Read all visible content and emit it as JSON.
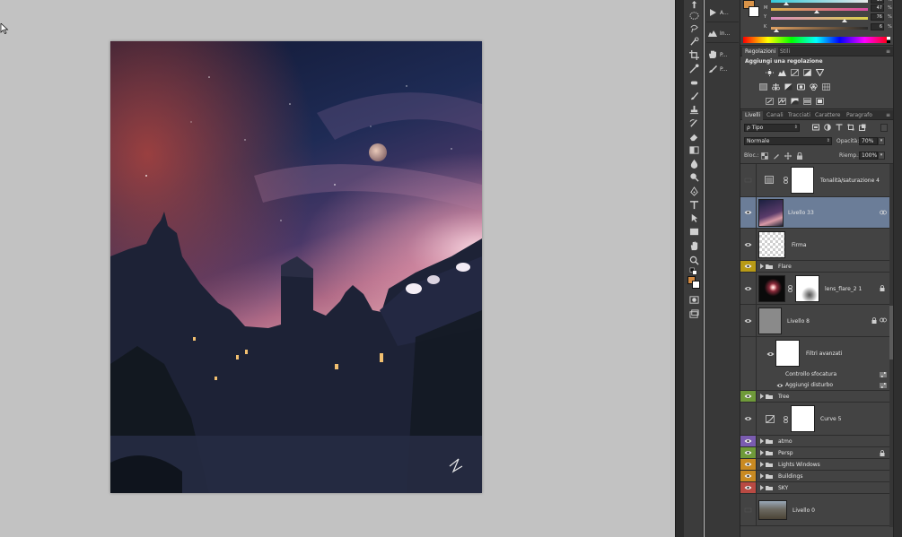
{
  "colors": {
    "workspace": "#c2c2c2",
    "panel": "#434343",
    "selected_layer": "#6b7d98",
    "foreground_swatch": "#d38a40",
    "background_swatch": "#ffffff",
    "label_yellow": "#b89a16",
    "label_green": "#6f9a3a",
    "label_violet": "#7a5cb0",
    "label_orange": "#c98a22",
    "label_red": "#b94a43"
  },
  "history": {
    "items": [
      {
        "label": "A...",
        "icon": "play-icon"
      },
      {
        "label": "In...",
        "icon": "levels-icon"
      },
      {
        "label": "P...",
        "icon": "hand-icon"
      },
      {
        "label": "P...",
        "icon": "brush-icon"
      }
    ]
  },
  "color_panel": {
    "rows": [
      {
        "letter": "",
        "value": "16",
        "pct": "%",
        "color_from": "#33c9d9",
        "color_to": "#e8e8e8",
        "pos": 0.16
      },
      {
        "letter": "M",
        "value": "47",
        "pct": "%",
        "color_from": "#d9b24a",
        "color_to": "#d94aa5",
        "pos": 0.47
      },
      {
        "letter": "Y",
        "value": "76",
        "pct": "%",
        "color_from": "#d98bc0",
        "color_to": "#d9d04a",
        "pos": 0.76
      },
      {
        "letter": "K",
        "value": "6",
        "pct": "%",
        "color_from": "#e0a060",
        "color_to": "#2a2a2a",
        "pos": 0.06
      }
    ]
  },
  "adjustments": {
    "tabs": [
      "Regolazioni",
      "Stili"
    ],
    "title": "Aggiungi una regolazione"
  },
  "layers": {
    "tabs": [
      "Livelli",
      "Canali",
      "Tracciati",
      "Carattere",
      "Paragrafo"
    ],
    "filter": "ρ Tipo",
    "blend_mode": "Normale",
    "opacity_label": "Opacità:",
    "opacity_value": "70%",
    "lock_label": "Bloc.:",
    "fill_label": "Riemp.:",
    "fill_value": "100%",
    "items": [
      {
        "name": "Tonalità/saturazione 4",
        "kind": "adjustment"
      },
      {
        "name": "Livello 33",
        "kind": "image",
        "selected": true
      },
      {
        "name": "Firma",
        "kind": "smart"
      },
      {
        "name": "Flare",
        "kind": "group",
        "label": "yellow"
      },
      {
        "name": "lens_flare_2 1",
        "kind": "masked"
      },
      {
        "name": "Livello 8",
        "kind": "smart-filter"
      },
      {
        "name": "Filtri avanzati",
        "kind": "filter-mask"
      },
      {
        "name": "Controllo sfocatura",
        "kind": "filter"
      },
      {
        "name": "Aggiungi disturbo",
        "kind": "filter"
      },
      {
        "name": "Tree",
        "kind": "group",
        "label": "green"
      },
      {
        "name": "Curve 5",
        "kind": "curves"
      },
      {
        "name": "atmo",
        "kind": "group",
        "label": "violet"
      },
      {
        "name": "Persp",
        "kind": "group",
        "label": "green"
      },
      {
        "name": "Lights Windows",
        "kind": "group",
        "label": "orange"
      },
      {
        "name": "Buildings",
        "kind": "group",
        "label": "orange"
      },
      {
        "name": "SKY",
        "kind": "group",
        "label": "red"
      },
      {
        "name": "Livello 0",
        "kind": "photo"
      }
    ]
  }
}
